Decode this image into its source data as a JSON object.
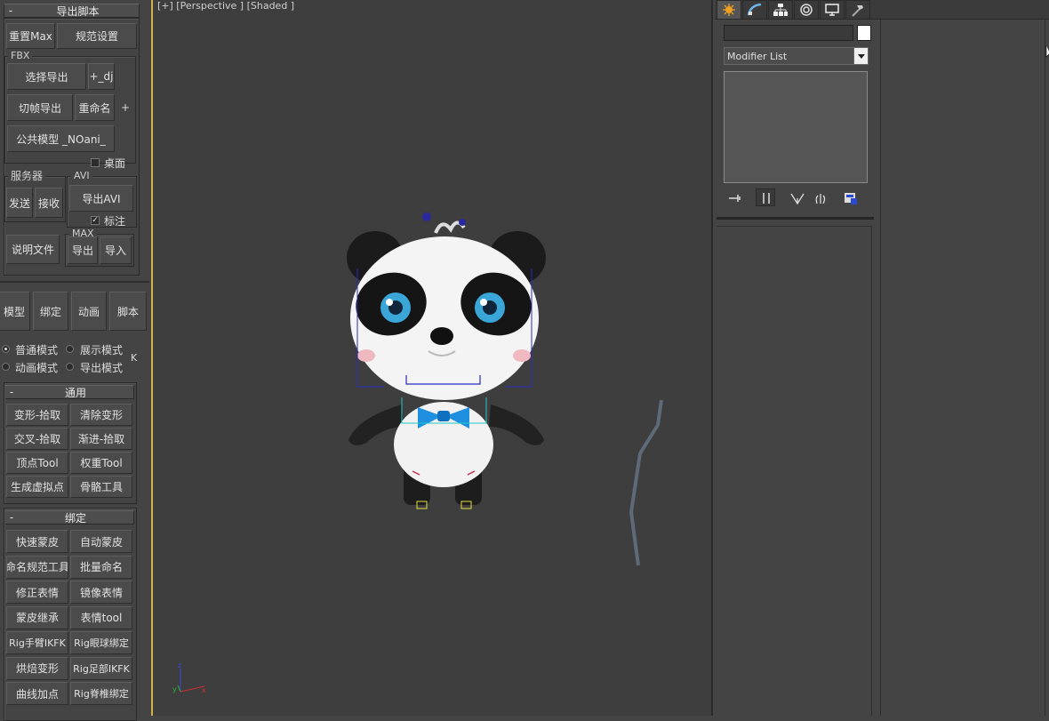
{
  "export_panel": {
    "title": "导出脚本",
    "reset_max": "重置Max",
    "spec_settings": "规范设置",
    "fbx_group": "FBX",
    "select_export": "选择导出",
    "plus_dj": "+_dj",
    "frame_export": "切帧导出",
    "rename": "重命名",
    "plus": "+",
    "public_model": "公共模型 _NOani_",
    "desktop_label": "桌面",
    "server_group": "服务器",
    "send": "发送",
    "receive": "接收",
    "avi_group": "AVI",
    "export_avi": "导出AVI",
    "annotate_label": "标注",
    "docs": "说明文件",
    "max_group": "MAX",
    "max_export": "导出",
    "max_import": "导入"
  },
  "mode_tabs": [
    "模型",
    "绑定",
    "动画",
    "脚本"
  ],
  "modes": {
    "normal": "普通模式",
    "display": "展示模式",
    "animation": "动画模式",
    "export": "导出模式",
    "k": "K"
  },
  "general": {
    "title": "通用",
    "buttons": [
      "变形-拾取",
      "清除变形",
      "交叉-拾取",
      "渐进-拾取",
      "顶点Tool",
      "权重Tool",
      "生成虚拟点",
      "骨骼工具"
    ]
  },
  "binding": {
    "title": "绑定",
    "buttons": [
      "快速蒙皮",
      "自动蒙皮",
      "命名规范工具",
      "批量命名",
      "修正表情",
      "镜像表情",
      "蒙皮继承",
      "表情tool",
      "Rig手臂IKFK",
      "Rig眼球绑定",
      "烘焙变形",
      "Rig足部IKFK",
      "曲线加点",
      "Rig脊椎绑定"
    ]
  },
  "viewport": {
    "label": "[+] [Perspective ] [Shaded ]"
  },
  "command_panel": {
    "modifier_list": "Modifier List"
  }
}
